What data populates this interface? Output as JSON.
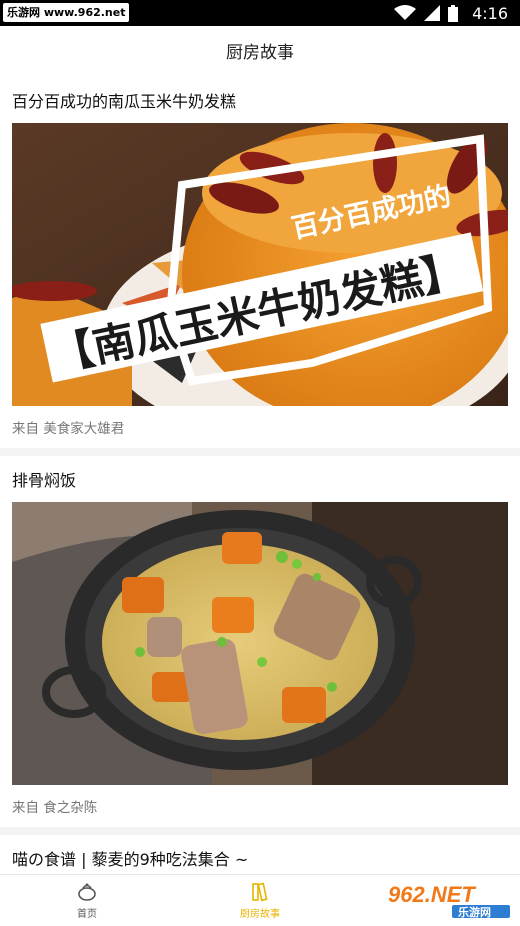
{
  "status_bar": {
    "watermark": "乐游网 www.962.net",
    "time": "4:16"
  },
  "app_bar": {
    "title": "厨房故事"
  },
  "cards": [
    {
      "title": "百分百成功的南瓜玉米牛奶发糕",
      "image_caption_line1": "百分百成功的",
      "image_caption_line2": "【南瓜玉米牛奶发糕】",
      "source": "来自  美食家大雄君"
    },
    {
      "title": "排骨焖饭",
      "source": "来自  食之杂陈"
    },
    {
      "title": "喵の食谱 | 藜麦的9种吃法集合 ~"
    }
  ],
  "tab_bar": {
    "home_label": "首页",
    "kitchen_label": "厨房故事",
    "active_color": "#e9b400"
  },
  "logo_watermark": {
    "brand": "962.NET",
    "sub": "乐游网"
  }
}
